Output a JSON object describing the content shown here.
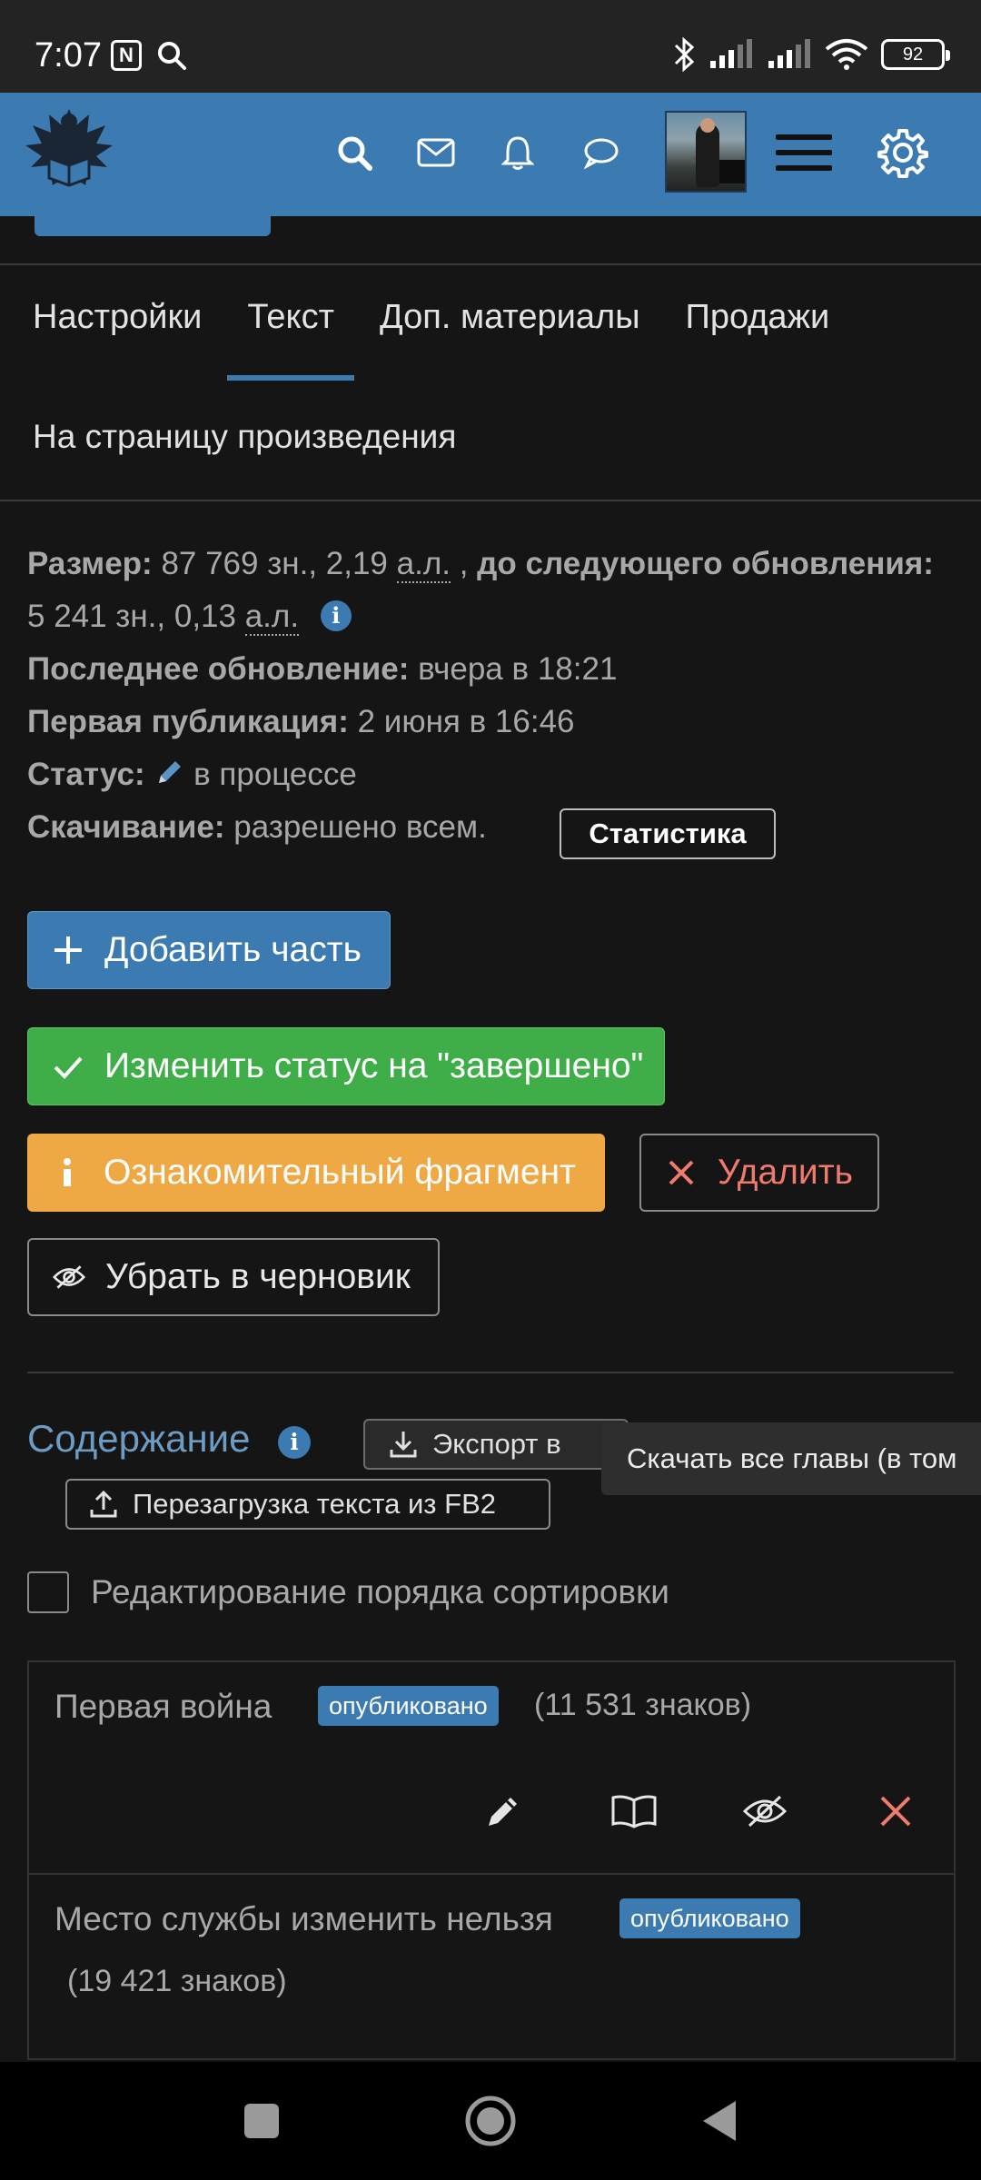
{
  "status_bar": {
    "time": "7:07",
    "nfc_label": "N",
    "battery": "92"
  },
  "header": {
    "icons": [
      "logo-eagle-icon",
      "search-icon",
      "mail-icon",
      "bell-icon",
      "chat-icon",
      "avatar",
      "hamburger-icon",
      "gear-icon"
    ]
  },
  "tabs": [
    {
      "label": "Настройки",
      "active": false
    },
    {
      "label": "Текст",
      "active": true
    },
    {
      "label": "Доп. материалы",
      "active": false
    },
    {
      "label": "Продажи",
      "active": false
    }
  ],
  "work_link": "На страницу произведения",
  "info": {
    "size_label": "Размер:",
    "size_value": "87 769 зн., 2,19",
    "al1": "а.л.",
    "comma": ",",
    "next_label": "до следующего обновления:",
    "next_value": "5 241 зн., 0,13",
    "al2": "а.л.",
    "last_update_label": "Последнее обновление:",
    "last_update_value": "вчера в 18:21",
    "first_pub_label": "Первая публикация:",
    "first_pub_value": "2 июня в 16:46",
    "status_label": "Статус:",
    "status_value": "в процессе",
    "download_label": "Скачивание:",
    "download_value": "разрешено всем.",
    "stats_button": "Статистика"
  },
  "actions": {
    "add_part": "Добавить часть",
    "change_status": "Изменить статус на \"завершено\"",
    "preview_fragment": "Ознакомительный фрагмент",
    "delete": "Удалить",
    "to_draft": "Убрать в черновик"
  },
  "contents": {
    "title": "Содержание",
    "export_label": "Экспорт в",
    "tooltip": "Скачать все главы (в том",
    "reload_label": "Перезагрузка текста из FB2",
    "sort_label": "Редактирование порядка сортировки"
  },
  "chapters": [
    {
      "title": "Первая война",
      "badge": "опубликовано",
      "chars": "(11 531 знаков)"
    },
    {
      "title": "Место службы изменить нельзя",
      "badge": "опубликовано",
      "chars": "(19 421 знаков)"
    }
  ],
  "colors": {
    "accent": "#3c7ab2",
    "success": "#3fae49",
    "warning": "#eea844",
    "danger": "#f07a6e",
    "background": "#151515"
  }
}
